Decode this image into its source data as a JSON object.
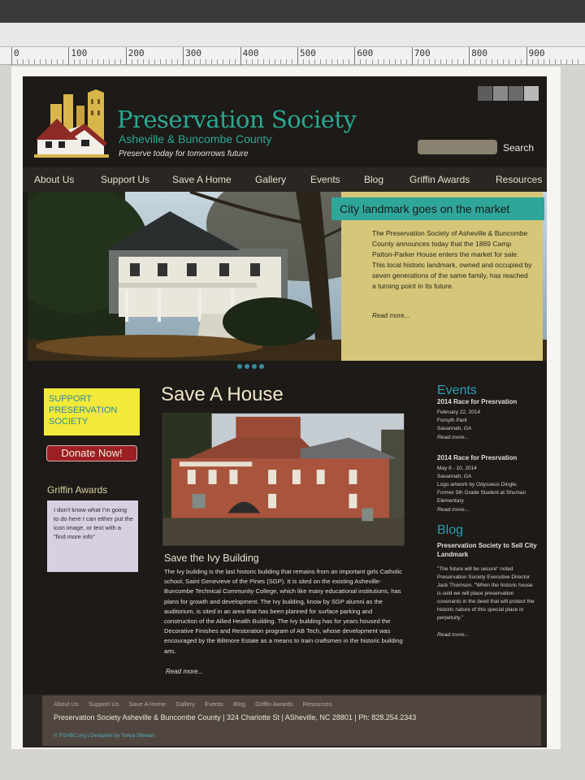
{
  "ruler": {
    "numbers": [
      "0",
      "100",
      "200",
      "300",
      "400",
      "500",
      "600",
      "700",
      "800",
      "900"
    ]
  },
  "header": {
    "title": "Preservation Society",
    "subtitle": "Asheville & Buncombe County",
    "tagline": "Preserve today for tomorrows future",
    "search_label": "Search"
  },
  "nav": {
    "items": [
      "About Us",
      "Support Us",
      "Save A Home",
      "Gallery",
      "Events",
      "Blog",
      "Griffin Awards",
      "Resources"
    ]
  },
  "hero": {
    "headline": "City landmark goes on the market",
    "text": "The Preservation Society of Asheville & Buncombe County announces today that the 1869 Camp Patton-Parker House enters the market for sale. This local historic landmark, owned and occupied by seven generations of the same family, has reached a turning point in its future.",
    "more": "Read more..."
  },
  "sidebar": {
    "support_text": "SUPPORT PRESERVATION SOCIETY",
    "donate_label": "Donate Now!",
    "griffin_title": "Griffin Awards",
    "griffin_text": "I don't know what I'm going to do here I can either put the icon image, or text with a \"find more info\""
  },
  "main": {
    "heading": "Save A House",
    "subheading": "Save the Ivy Building",
    "body": "The Ivy building is the last historic building that remains from an important girls Catholic school, Saint Genevieve of the Pines (SGP). It is sited on the existing Asheville-Buncombe Technical Community College, which like many educational institutions, has plans for growth and development. The Ivy building, know by SGP alumni as the auditorium, is sited in an area that has been planned for surface parking and construction of the Allied Health Building. The Ivy building has for years housed the Decorative Finishes and Restoration program of AB Tech, whose development was encouraged by the Biltmore Estate as a means to train craftsmen in the historic building arts.",
    "more": "Read more..."
  },
  "events": {
    "title": "Events",
    "items": [
      {
        "name": "2014 Race for Presrvation",
        "date": "February 22, 2014",
        "place1": "Forsyth Park",
        "place2": "Savannah, GA",
        "more": "Read more..."
      },
      {
        "name": "2014 Race for Presrvation",
        "date": "May 8 - 10, 2014",
        "place1": "Savannah, GA",
        "place2": "Logo artwork by Odysseus Dingle, Former 5th Grade Student at Shuman Elementary",
        "more": "Read more..."
      }
    ]
  },
  "blog": {
    "title": "Blog",
    "post_title": "Preservation Society to Sell City Landmark",
    "post_text": "\"The future will be secure\" noted Preservation Society Executive Director Jack Thomson. \"When the historic house is sold we will place preservation covenants in the deed that will protect the historic nature of this special place in perpetuity.\"",
    "more": "Read more..."
  },
  "footer": {
    "links": [
      "About Us",
      "Support Us",
      "Save A Home",
      "Gallery",
      "Events",
      "Blog",
      "Griffin Awards",
      "Resources"
    ],
    "address": "Preservation Society Asheville & Buncombe County |   324 Charlotte St |   ASheville, NC 28801 |   Ph: 828.254.2343",
    "credit": "© PSABC.org | Designed by Tonya Stewart"
  },
  "colors": {
    "accent_teal": "#2aa893",
    "background": "#1d1a17",
    "feature_yellow": "#d6c67a",
    "donate_red": "#9c1f24",
    "support_yellow": "#f2e93a"
  }
}
